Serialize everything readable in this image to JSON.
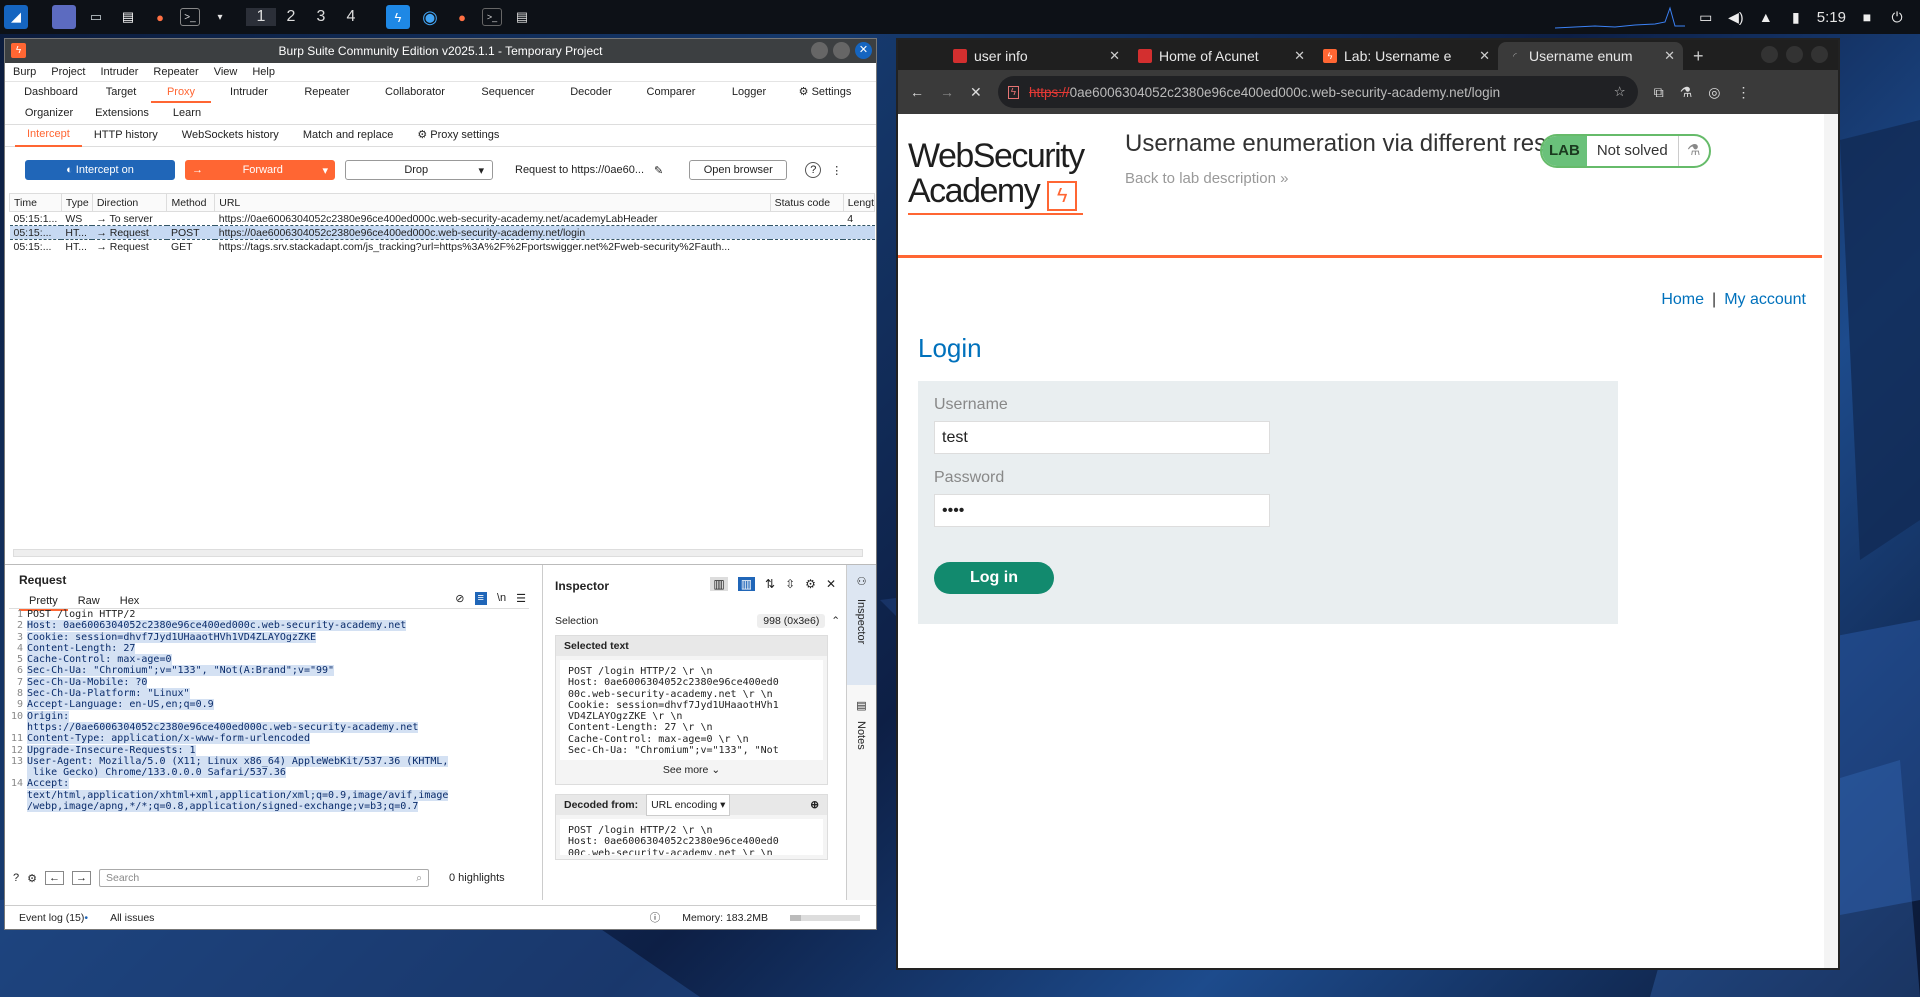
{
  "taskbar": {
    "workspaces": [
      "1",
      "2",
      "3",
      "4"
    ],
    "clock": "5:19"
  },
  "burp": {
    "title": "Burp Suite Community Edition v2025.1.1 - Temporary Project",
    "menu": [
      "Burp",
      "Project",
      "Intruder",
      "Repeater",
      "View",
      "Help"
    ],
    "tabs": [
      "Dashboard",
      "Target",
      "Proxy",
      "Intruder",
      "Repeater",
      "Collaborator",
      "Sequencer",
      "Decoder",
      "Comparer",
      "Logger",
      "Settings",
      "Organizer",
      "Extensions",
      "Learn"
    ],
    "subtabs": [
      "Intercept",
      "HTTP history",
      "WebSockets history",
      "Match and replace",
      "Proxy settings"
    ],
    "toolbar": {
      "intercept": "Intercept on",
      "forward": "Forward",
      "drop": "Drop",
      "request_to": "Request to https://0ae60...",
      "open_browser": "Open browser"
    },
    "table": {
      "headers": [
        "Time",
        "Type",
        "Direction",
        "Method",
        "URL",
        "Status code",
        "Lengt"
      ],
      "rows": [
        {
          "time": "05:15:1...",
          "type": "WS",
          "dir": "To server",
          "method": "",
          "url": "https://0ae6006304052c2380e96ce400ed000c.web-security-academy.net/academyLabHeader",
          "status": "",
          "len": "4"
        },
        {
          "time": "05:15:...",
          "type": "HT...",
          "dir": "Request",
          "method": "POST",
          "url": "https://0ae6006304052c2380e96ce400ed000c.web-security-academy.net/login",
          "status": "",
          "len": ""
        },
        {
          "time": "05:15:...",
          "type": "HT...",
          "dir": "Request",
          "method": "GET",
          "url": "https://tags.srv.stackadapt.com/js_tracking?url=https%3A%2F%2Fportswigger.net%2Fweb-security%2Fauth...",
          "status": "",
          "len": ""
        }
      ]
    },
    "request": {
      "title": "Request",
      "tabs": [
        "Pretty",
        "Raw",
        "Hex"
      ],
      "lines": [
        {
          "n": "1",
          "t": "POST /login HTTP/2"
        },
        {
          "n": "2",
          "t": "Host: 0ae6006304052c2380e96ce400ed000c.web-security-academy.net"
        },
        {
          "n": "3",
          "t": "Cookie: session=dhvf7Jyd1UHaaotHVh1VD4ZLAYOgzZKE"
        },
        {
          "n": "4",
          "t": "Content-Length: 27"
        },
        {
          "n": "5",
          "t": "Cache-Control: max-age=0"
        },
        {
          "n": "6",
          "t": "Sec-Ch-Ua: \"Chromium\";v=\"133\", \"Not(A:Brand\";v=\"99\""
        },
        {
          "n": "7",
          "t": "Sec-Ch-Ua-Mobile: ?0"
        },
        {
          "n": "8",
          "t": "Sec-Ch-Ua-Platform: \"Linux\""
        },
        {
          "n": "9",
          "t": "Accept-Language: en-US,en;q=0.9"
        },
        {
          "n": "10",
          "t": "Origin:"
        },
        {
          "n": "",
          "t": "https://0ae6006304052c2380e96ce400ed000c.web-security-academy.net"
        },
        {
          "n": "11",
          "t": "Content-Type: application/x-www-form-urlencoded"
        },
        {
          "n": "12",
          "t": "Upgrade-Insecure-Requests: 1"
        },
        {
          "n": "13",
          "t": "User-Agent: Mozilla/5.0 (X11; Linux x86_64) AppleWebKit/537.36 (KHTML,"
        },
        {
          "n": "",
          "t": " like Gecko) Chrome/133.0.0.0 Safari/537.36"
        },
        {
          "n": "14",
          "t": "Accept:"
        },
        {
          "n": "",
          "t": "text/html,application/xhtml+xml,application/xml;q=0.9,image/avif,image"
        },
        {
          "n": "",
          "t": "/webp,image/apng,*/*;q=0.8,application/signed-exchange;v=b3;q=0.7"
        }
      ],
      "search_placeholder": "Search",
      "highlights": "0 highlights"
    },
    "inspector": {
      "title": "Inspector",
      "selection_label": "Selection",
      "selection_value": "998 (0x3e6)",
      "selected_text": "Selected text",
      "selected_body": "POST /login HTTP/2 \\r \\n\nHost: 0ae6006304052c2380e96ce400ed0\n00c.web-security-academy.net \\r \\n\nCookie: session=dhvf7Jyd1UHaaotHVh1\nVD4ZLAYOgzZKE \\r \\n\nContent-Length: 27 \\r \\n\nCache-Control: max-age=0 \\r \\n\nSec-Ch-Ua: \"Chromium\";v=\"133\", \"Not",
      "see_more": "See more",
      "decoded_from": "Decoded from:",
      "decoded_enc": "URL encoding",
      "decoded_body": "POST /login HTTP/2 \\r \\n\nHost: 0ae6006304052c2380e96ce400ed0\n00c.web-security-academy.net \\r \\n",
      "side_inspector": "Inspector",
      "side_notes": "Notes"
    },
    "status": {
      "event_log": "Event log (15)",
      "all_issues": "All issues",
      "memory": "Memory: 183.2MB"
    }
  },
  "chrome": {
    "tabs": [
      {
        "label": "user info",
        "color": "#d32f2f"
      },
      {
        "label": "Home of Acunet",
        "color": "#d32f2f"
      },
      {
        "label": "Lab: Username e",
        "color": "#ff6633"
      },
      {
        "label": "Username enum",
        "color": "#555555"
      }
    ],
    "url_scheme": "https://",
    "url_rest": "0ae6006304052c2380e96ce400ed000c.web-security-academy.net/login",
    "page": {
      "logo_line1": "WebSecurity",
      "logo_line2": "Academy",
      "lab_title": "Username enumeration via different responses",
      "back_link": "Back to lab description",
      "lab_badge": "LAB",
      "lab_status": "Not solved",
      "home": "Home",
      "sep": "|",
      "my_account": "My account",
      "login_heading": "Login",
      "username_label": "Username",
      "username_value": "test",
      "password_label": "Password",
      "password_value": "••••",
      "login_button": "Log in"
    }
  }
}
